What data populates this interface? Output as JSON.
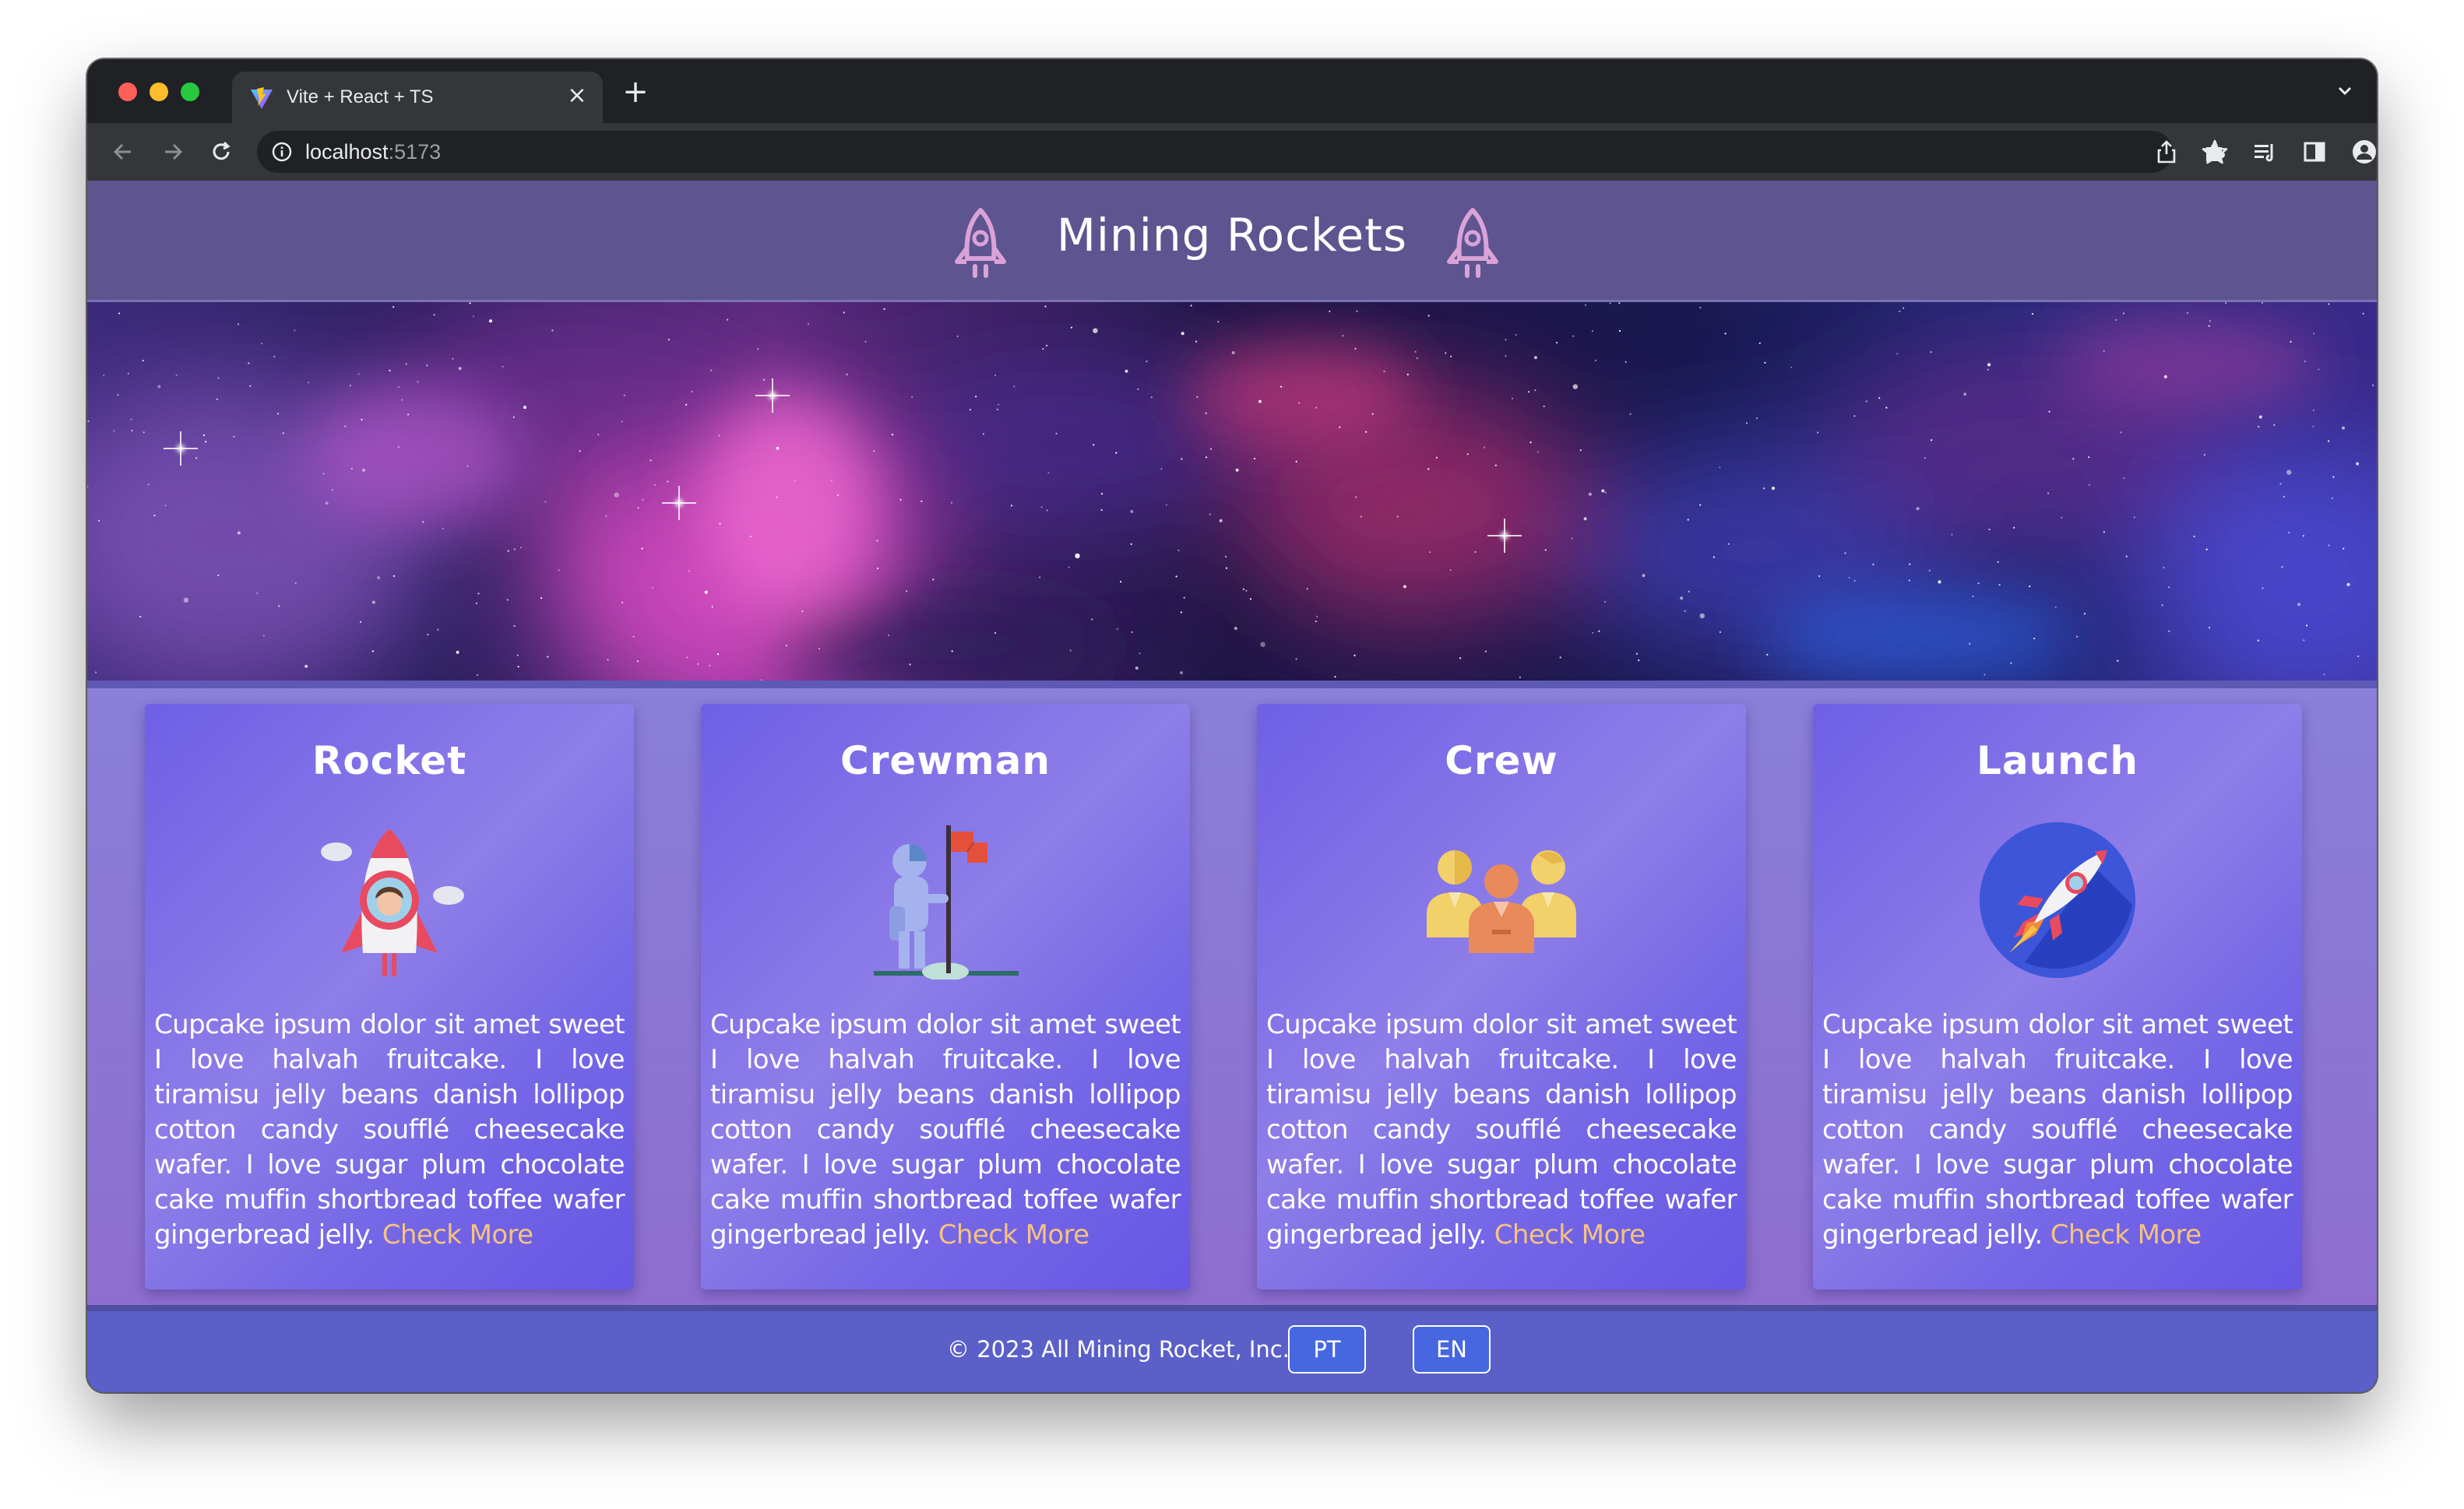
{
  "browser": {
    "tab_title": "Vite + React + TS",
    "url_host": "localhost",
    "url_port": ":5173"
  },
  "site": {
    "title": "Mining Rockets"
  },
  "cards": [
    {
      "title": "Rocket",
      "icon": "rocket-astronaut-icon",
      "text": "Cupcake ipsum dolor sit amet sweet I love halvah fruitcake. I love tiramisu jelly beans danish lollipop cotton candy soufflé cheesecake wafer. I love sugar plum chocolate cake muffin shortbread toffee wafer gingerbread jelly.",
      "link": "Check More"
    },
    {
      "title": "Crewman",
      "icon": "astronaut-flag-icon",
      "text": "Cupcake ipsum dolor sit amet sweet I love halvah fruitcake. I love tiramisu jelly beans danish lollipop cotton candy soufflé cheesecake wafer. I love sugar plum chocolate cake muffin shortbread toffee wafer gingerbread jelly.",
      "link": "Check More"
    },
    {
      "title": "Crew",
      "icon": "crew-group-icon",
      "text": "Cupcake ipsum dolor sit amet sweet I love halvah fruitcake. I love tiramisu jelly beans danish lollipop cotton candy soufflé cheesecake wafer. I love sugar plum chocolate cake muffin shortbread toffee wafer gingerbread jelly.",
      "link": "Check More"
    },
    {
      "title": "Launch",
      "icon": "rocket-launch-icon",
      "text": "Cupcake ipsum dolor sit amet sweet I love halvah fruitcake. I love tiramisu jelly beans danish lollipop cotton candy soufflé cheesecake wafer. I love sugar plum chocolate cake muffin shortbread toffee wafer gingerbread jelly.",
      "link": "Check More"
    }
  ],
  "footer": {
    "copyright": "© 2023 All Mining Rocket, Inc.",
    "lang_pt": "PT",
    "lang_en": "EN"
  },
  "colors": {
    "header_bg": "#5e5490",
    "card_accent_link": "#f5c37f",
    "footer_bg": "#5b5fc8",
    "lang_button_bg": "#4667e0"
  }
}
